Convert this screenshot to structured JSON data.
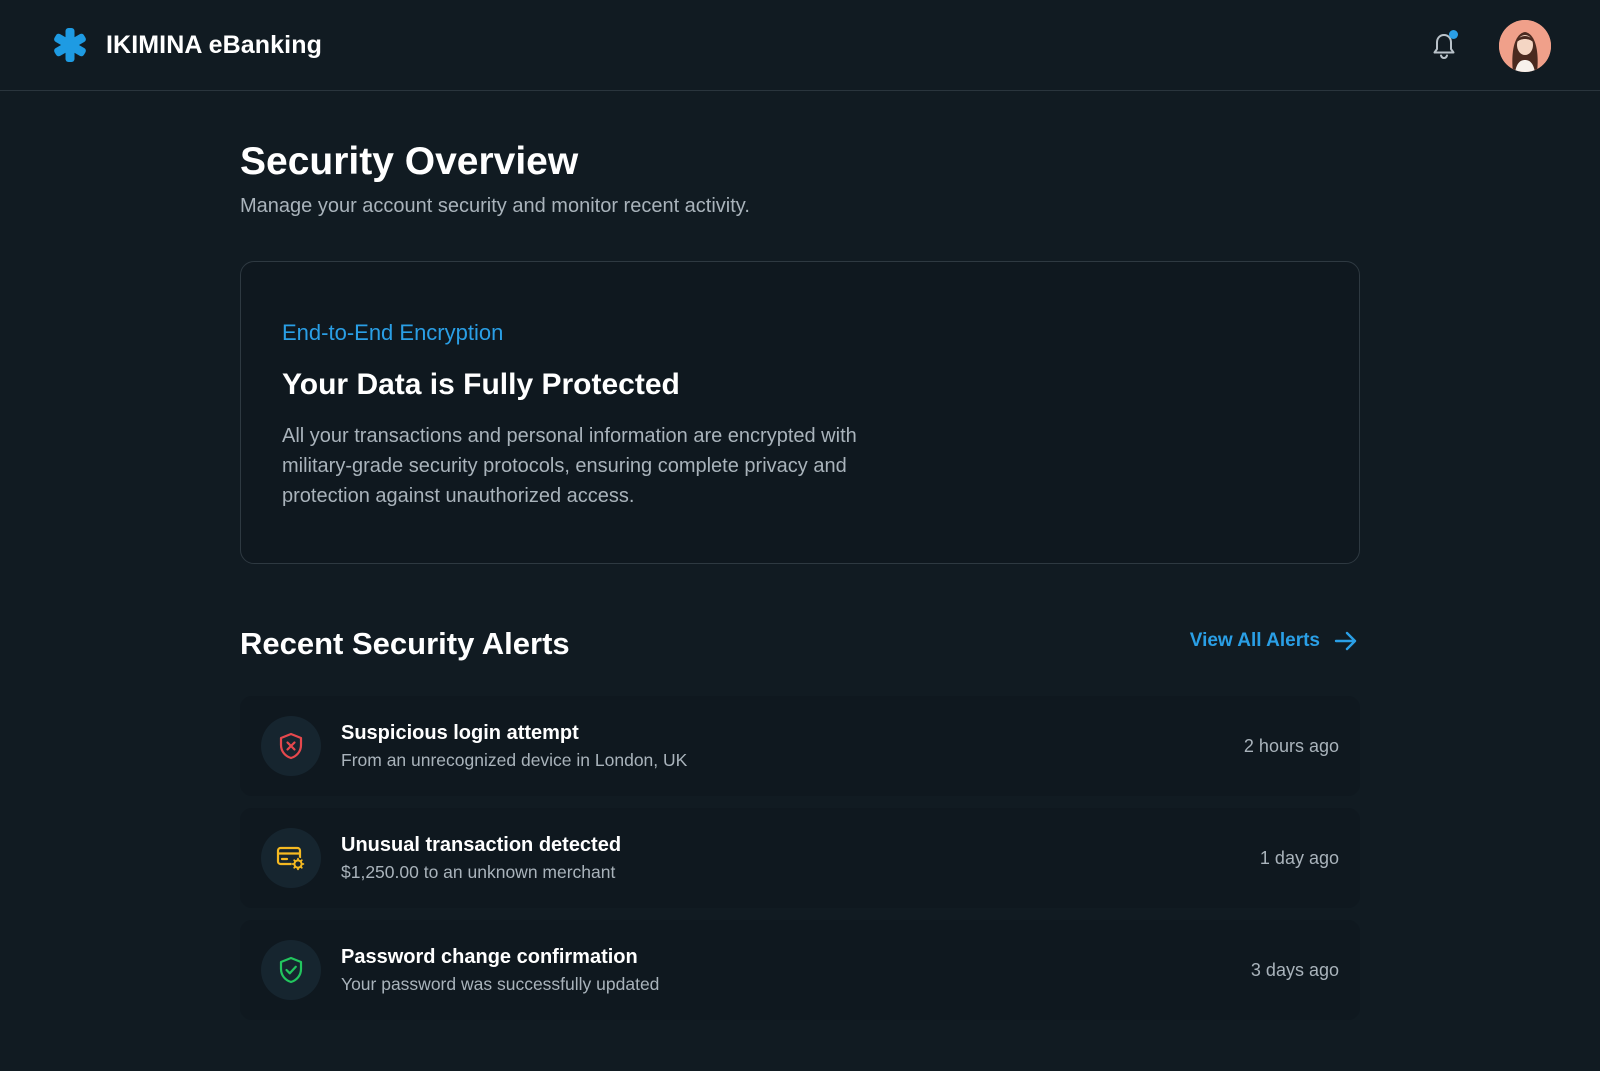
{
  "app": {
    "name": "IKIMINA eBanking",
    "accent_color": "#2a9fe6",
    "logo_icon": "asterisk-logo-icon"
  },
  "header": {
    "notification_icon": "bell-icon",
    "has_unread_notifications": true,
    "avatar_icon": "user-avatar"
  },
  "page": {
    "title": "Security Overview",
    "subtitle": "Manage your account security and monitor recent activity."
  },
  "encryption_card": {
    "kicker": "End-to-End Encryption",
    "title": "Your Data is Fully Protected",
    "body": "All your transactions and personal information are encrypted with military-grade security protocols, ensuring complete privacy and protection against unauthorized access."
  },
  "alerts": {
    "title": "Recent Security Alerts",
    "view_all_label": "View All Alerts",
    "items": [
      {
        "icon": "shield-x-icon",
        "icon_color": "#e5484d",
        "title": "Suspicious login attempt",
        "description": "From an unrecognized device in London, UK",
        "time": "2 hours ago"
      },
      {
        "icon": "card-settings-icon",
        "icon_color": "#f5b921",
        "title": "Unusual transaction detected",
        "description": "$1,250.00 to an unknown merchant",
        "time": "1 day ago"
      },
      {
        "icon": "shield-check-icon",
        "icon_color": "#22c55e",
        "title": "Password change confirmation",
        "description": "Your password was successfully updated",
        "time": "3 days ago"
      }
    ]
  }
}
